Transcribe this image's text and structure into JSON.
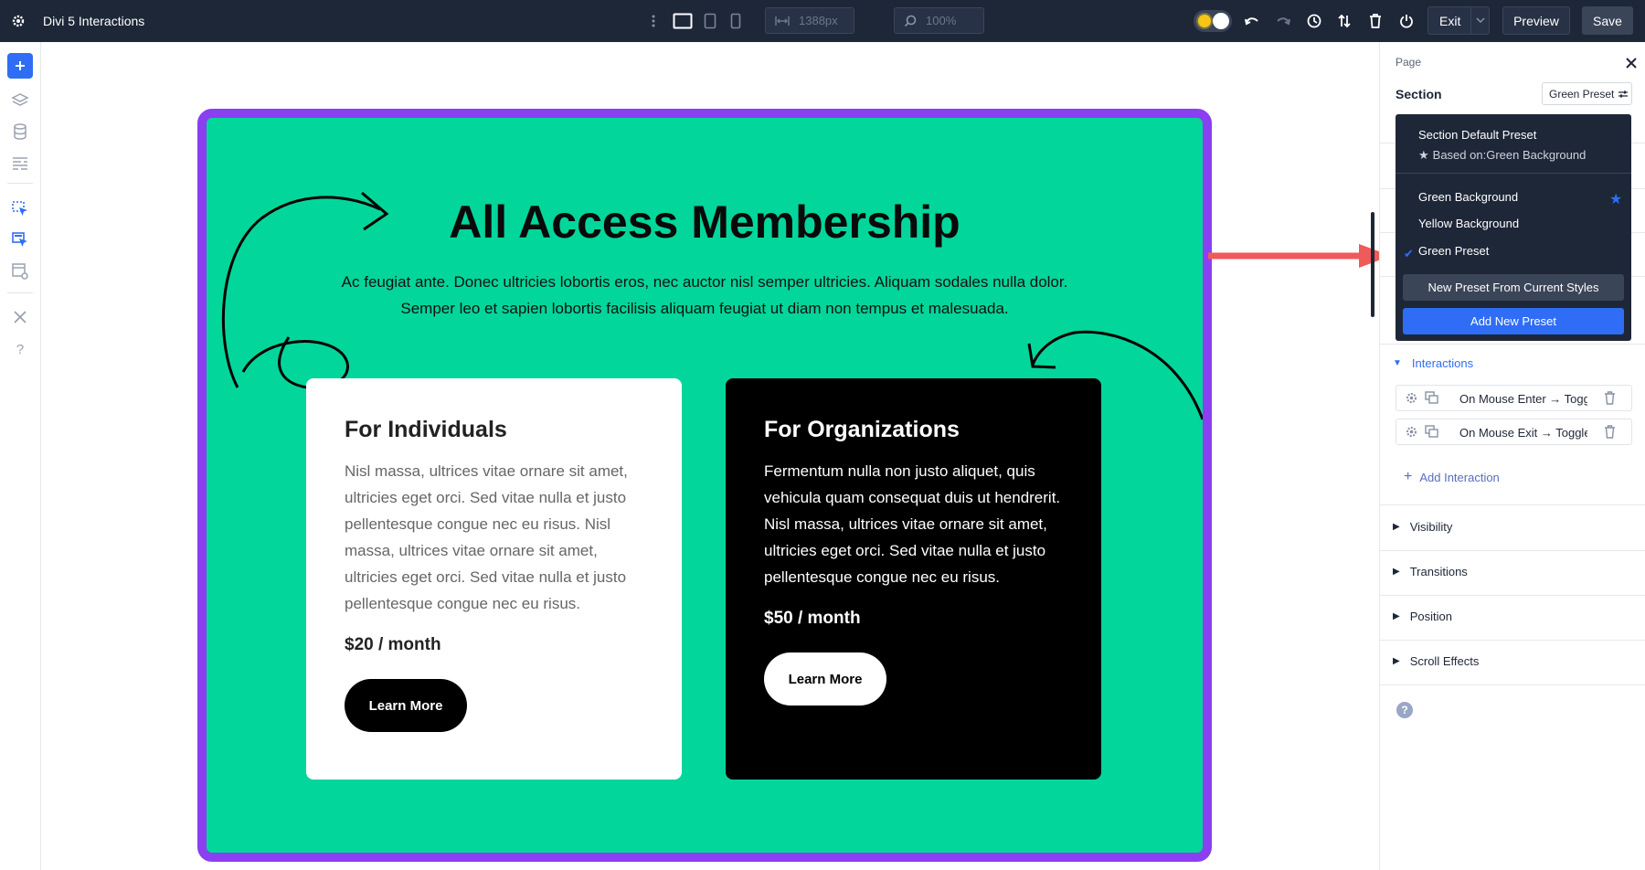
{
  "app": {
    "title": "Divi 5 Interactions"
  },
  "toolbar": {
    "width_value": "1388px",
    "zoom_value": "100%",
    "exit_label": "Exit",
    "preview_label": "Preview",
    "save_label": "Save"
  },
  "hero": {
    "title": "All Access Membership",
    "text": "Ac feugiat ante. Donec ultricies lobortis eros, nec auctor nisl semper ultricies. Aliquam sodales nulla dolor. Semper leo et sapien lobortis facilisis aliquam feugiat ut diam non tempus et malesuada."
  },
  "cards": [
    {
      "title": "For Individuals",
      "text": "Nisl massa, ultrices vitae ornare sit amet, ultricies eget orci. Sed vitae nulla et justo pellentesque congue nec eu risus. Nisl massa, ultrices vitae ornare sit amet, ultricies eget orci. Sed vitae nulla et justo pellentesque congue nec eu risus.",
      "price": "$20 / month",
      "button": "Learn More"
    },
    {
      "title": "For Organizations",
      "text": "Fermentum nulla non justo aliquet, quis vehicula quam consequat duis ut hendrerit. Nisl massa, ultrices vitae ornare sit amet, ultricies eget orci. Sed vitae nulla et justo pellentesque congue nec eu risus.",
      "price": "$50 / month",
      "button": "Learn More"
    }
  ],
  "panel": {
    "breadcrumb": "Page",
    "section_label": "Section",
    "preset_select": "Green Preset",
    "dropdown": {
      "default_title": "Section Default Preset",
      "default_based_on": "Based on:Green Background",
      "options": [
        "Green Background",
        "Yellow Background",
        "Green Preset"
      ],
      "new_from_current": "New Preset From Current Styles",
      "add_new": "Add New Preset"
    },
    "interactions_label": "Interactions",
    "interactions": [
      "On Mouse Enter → Toggle Preset",
      "On Mouse Exit → Toggle Preset"
    ],
    "add_interaction": "Add Interaction",
    "accordions": [
      "Visibility",
      "Transitions",
      "Position",
      "Scroll Effects"
    ],
    "help": "?"
  },
  "colors": {
    "accent": "#2f6df6",
    "section_bg": "#03d69b",
    "section_border": "#8a3ff0",
    "topbar": "#1e2738",
    "arrow": "#ef5a5a"
  }
}
